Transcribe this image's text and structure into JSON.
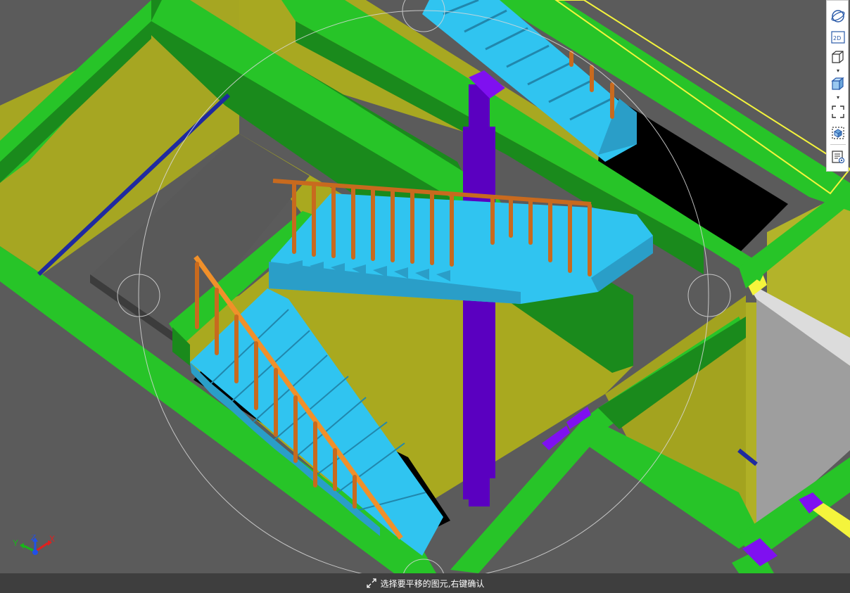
{
  "toolbar": {
    "buttons": [
      {
        "name": "orbit-view",
        "icon": "orbit-icon"
      },
      {
        "name": "2d-view",
        "icon": "2d-icon",
        "label": "2D"
      },
      {
        "name": "wireframe-box-view",
        "icon": "box-outline-icon",
        "has_dropdown": true
      },
      {
        "name": "shaded-box-view",
        "icon": "box-shaded-icon",
        "has_dropdown": true
      },
      {
        "name": "fit-view",
        "icon": "fit-extents-icon"
      },
      {
        "name": "component-view",
        "icon": "component-icon"
      },
      {
        "name": "properties-view",
        "icon": "properties-icon"
      }
    ]
  },
  "status": {
    "icon": "pan-cursor-icon",
    "text": "选择要平移的图元,右键确认"
  },
  "axis": {
    "x_label": "X",
    "y_label": "Y",
    "z_label": "Z",
    "x_color": "#e0201e",
    "y_color": "#18b818",
    "z_color": "#2050e8"
  },
  "colors": {
    "background": "#5b5b5b",
    "beam_green": "#27c428",
    "beam_dark_green": "#1a8a1c",
    "wall_olive": "#a8a821",
    "stair_cyan": "#30c4f0",
    "railing_orange": "#c86a1e",
    "column_purple": "#6a0ad8",
    "status_bar": "#3e3e3e"
  }
}
